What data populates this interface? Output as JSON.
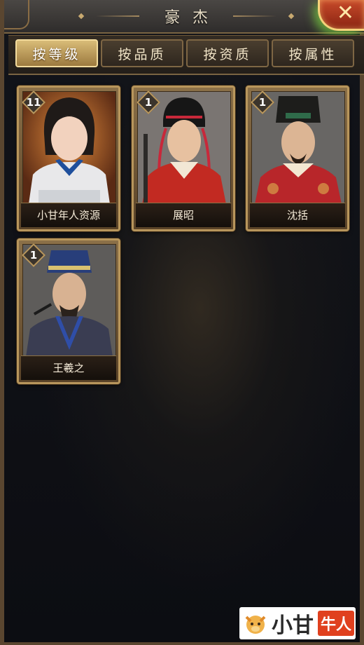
{
  "header": {
    "title": "豪杰",
    "close_label": "✕"
  },
  "tabs": [
    {
      "label": "按等级",
      "active": true
    },
    {
      "label": "按品质",
      "active": false
    },
    {
      "label": "按资质",
      "active": false
    },
    {
      "label": "按属性",
      "active": false
    }
  ],
  "heroes": [
    {
      "name": "小甘年人资源",
      "level": "11"
    },
    {
      "name": "展昭",
      "level": "1"
    },
    {
      "name": "沈括",
      "level": "1"
    },
    {
      "name": "王羲之",
      "level": "1"
    }
  ],
  "watermark": {
    "text_main": "小甘",
    "text_badge": "牛人"
  },
  "colors": {
    "accent_gold": "#b8965c",
    "close_red": "#c74a2a",
    "tab_active": "#d9bc78"
  }
}
